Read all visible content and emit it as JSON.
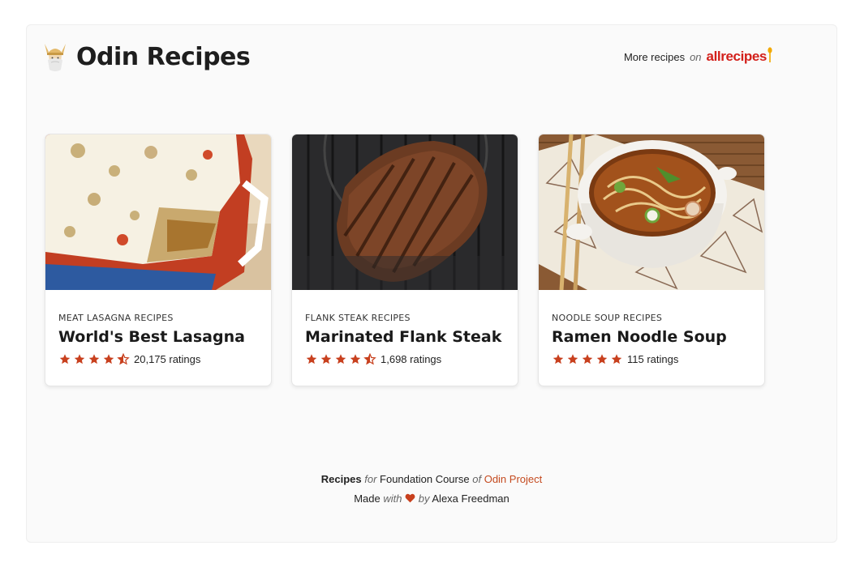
{
  "header": {
    "site_title": "Odin Recipes",
    "more_recipes_prefix": "More recipes",
    "more_recipes_on": "on",
    "allrecipes_brand": "allrecipes"
  },
  "icons": {
    "brand": "viking-helmet-icon",
    "allrecipes_spoon": "spoon-icon",
    "star": "star-icon",
    "half_star": "half-star-icon",
    "heart": "heart-icon"
  },
  "colors": {
    "accent": "#c8401e",
    "allrecipes_red": "#d3201b",
    "star": "#c8401e"
  },
  "cards": [
    {
      "category": "Meat Lasagna Recipes",
      "title": "World's Best Lasagna",
      "rating": 4.5,
      "ratings_text": "20,175 ratings",
      "image": "lasagna-photo"
    },
    {
      "category": "Flank Steak Recipes",
      "title": "Marinated Flank Steak",
      "rating": 4.5,
      "ratings_text": "1,698 ratings",
      "image": "flank-steak-photo"
    },
    {
      "category": "Noodle Soup Recipes",
      "title": "Ramen Noodle Soup",
      "rating": 5,
      "ratings_text": "115 ratings",
      "image": "ramen-soup-photo"
    }
  ],
  "footer": {
    "line1": {
      "recipes": "Recipes",
      "for": "for",
      "course": "Foundation Course",
      "of": "of",
      "project_link": "Odin Project"
    },
    "line2": {
      "made": "Made",
      "with": "with",
      "by": "by",
      "author": "Alexa Freedman"
    }
  }
}
